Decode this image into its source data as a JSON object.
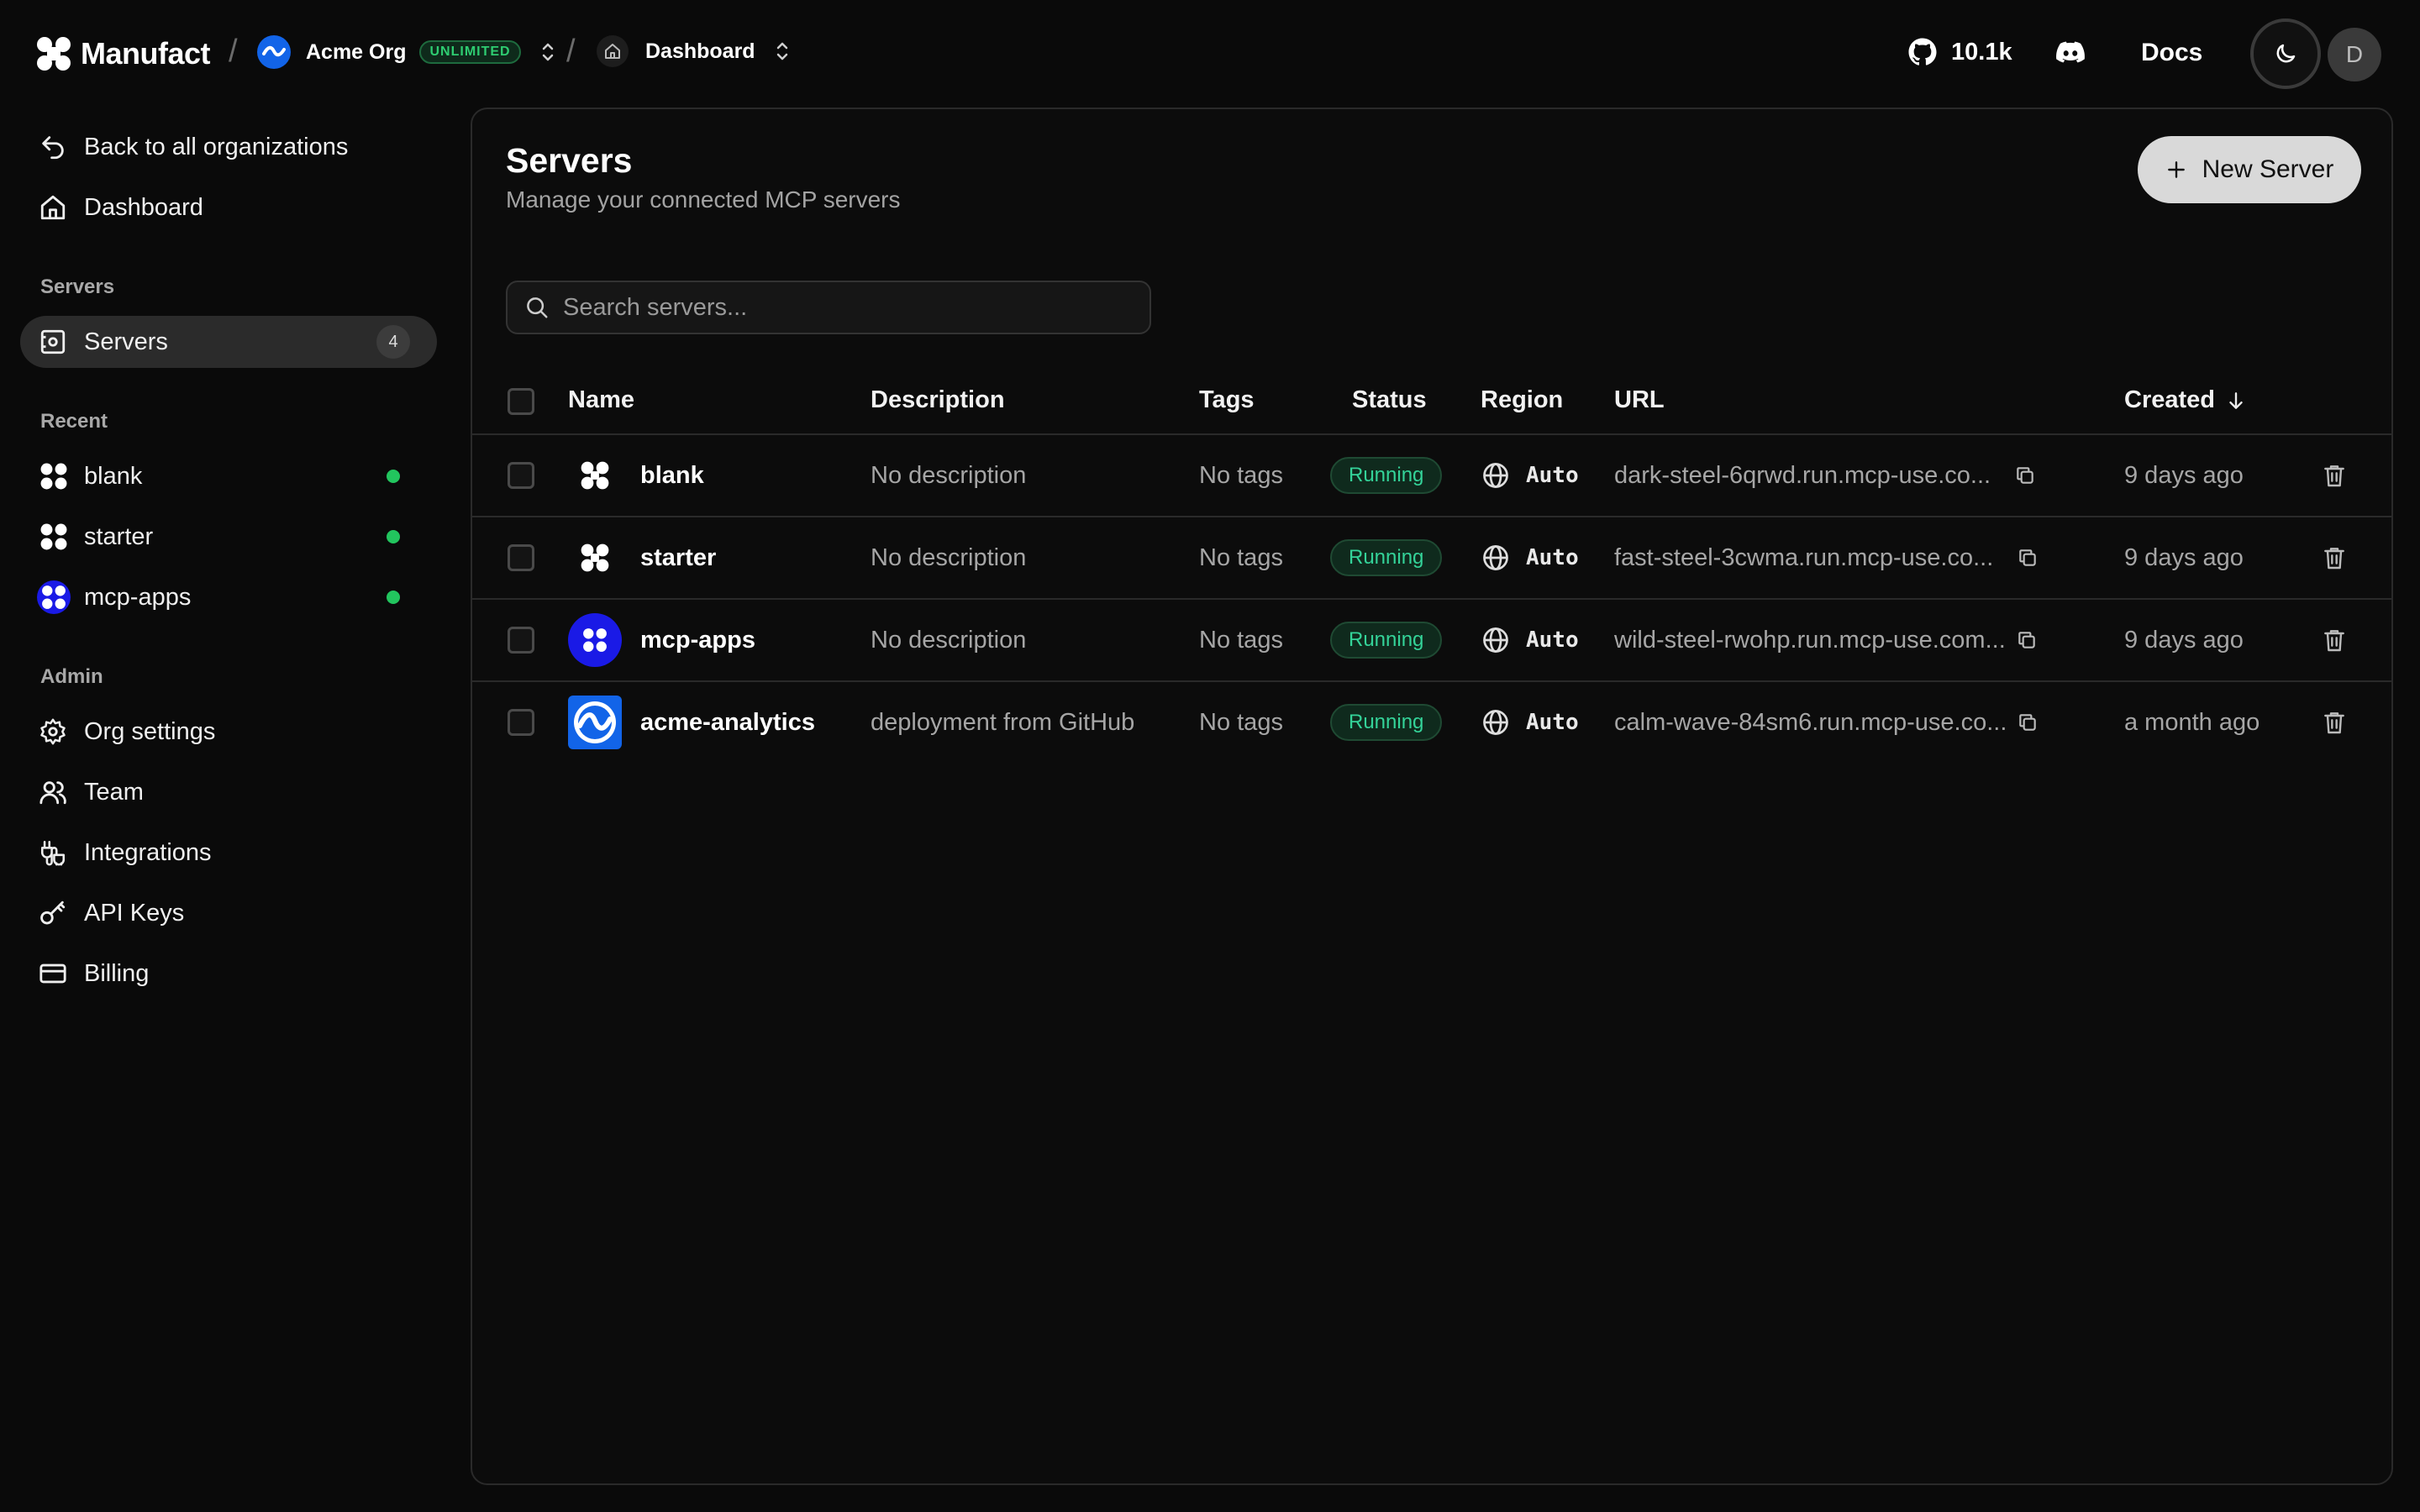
{
  "brand": {
    "name": "Manufact"
  },
  "org": {
    "name": "Acme Org",
    "plan_badge": "UNLIMITED"
  },
  "breadcrumb": {
    "current": "Dashboard"
  },
  "header": {
    "github_stars": "10.1k",
    "docs_label": "Docs",
    "avatar_initial": "D"
  },
  "sidebar": {
    "back_label": "Back to all organizations",
    "dashboard_label": "Dashboard",
    "servers_section": "Servers",
    "servers_item": {
      "label": "Servers",
      "count": "4"
    },
    "recent_section": "Recent",
    "recent": [
      {
        "label": "blank"
      },
      {
        "label": "starter"
      },
      {
        "label": "mcp-apps"
      }
    ],
    "admin_section": "Admin",
    "admin": [
      {
        "label": "Org settings"
      },
      {
        "label": "Team"
      },
      {
        "label": "Integrations"
      },
      {
        "label": "API Keys"
      },
      {
        "label": "Billing"
      }
    ]
  },
  "main": {
    "title": "Servers",
    "subtitle": "Manage your connected MCP servers",
    "new_button": "New Server",
    "search_placeholder": "Search servers...",
    "columns": {
      "name": "Name",
      "description": "Description",
      "tags": "Tags",
      "status": "Status",
      "region": "Region",
      "url": "URL",
      "created": "Created"
    },
    "rows": [
      {
        "name": "blank",
        "description": "No description",
        "tags": "No tags",
        "status": "Running",
        "region": "Auto",
        "url": "dark-steel-6qrwd.run.mcp-use.co...",
        "created": "9 days ago"
      },
      {
        "name": "starter",
        "description": "No description",
        "tags": "No tags",
        "status": "Running",
        "region": "Auto",
        "url": "fast-steel-3cwma.run.mcp-use.co...",
        "created": "9 days ago"
      },
      {
        "name": "mcp-apps",
        "description": "No description",
        "tags": "No tags",
        "status": "Running",
        "region": "Auto",
        "url": "wild-steel-rwohp.run.mcp-use.com...",
        "created": "9 days ago"
      },
      {
        "name": "acme-analytics",
        "description": "deployment from GitHub",
        "tags": "No tags",
        "status": "Running",
        "region": "Auto",
        "url": "calm-wave-84sm6.run.mcp-use.co...",
        "created": "a month ago"
      }
    ]
  },
  "colors": {
    "background": "#0a0a0a",
    "accent_green": "#22c55e",
    "org_blue": "#1264e8",
    "mcp_blue": "#1a1ae6"
  }
}
